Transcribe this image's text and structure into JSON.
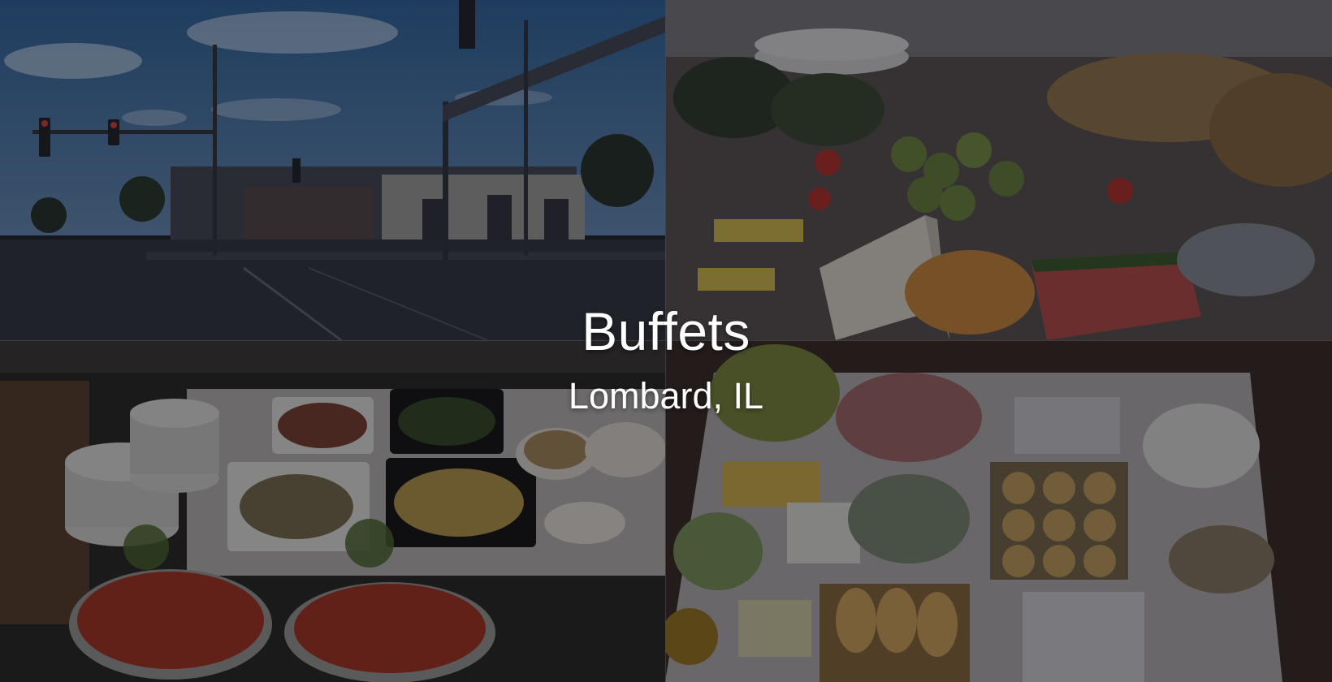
{
  "hero": {
    "title": "Buffets",
    "subtitle": "Lombard, IL"
  },
  "colors": {
    "text": "#ffffff",
    "overlay": "#0c0e16"
  },
  "tiles": [
    {
      "name": "street-intersection-photo"
    },
    {
      "name": "fruit-cheese-platter-photo"
    },
    {
      "name": "crawfish-salad-buffet-photo"
    },
    {
      "name": "breakfast-buffet-table-photo"
    }
  ]
}
